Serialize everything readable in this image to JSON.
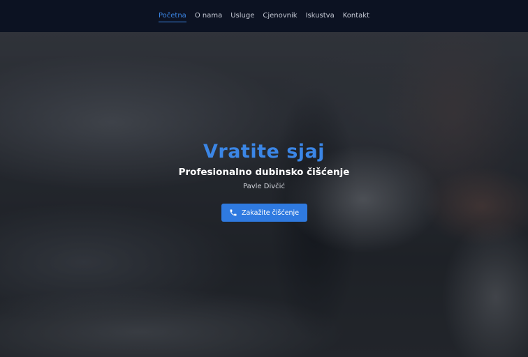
{
  "nav": {
    "items": [
      {
        "label": "Početna",
        "active": true
      },
      {
        "label": "O nama",
        "active": false
      },
      {
        "label": "Usluge",
        "active": false
      },
      {
        "label": "Cjenovnik",
        "active": false
      },
      {
        "label": "Iskustva",
        "active": false
      },
      {
        "label": "Kontakt",
        "active": false
      }
    ]
  },
  "hero": {
    "title": "Vratite sjaj",
    "subtitle": "Profesionalno dubinsko čišćenje",
    "author": "Pavle Divčić",
    "cta_label": "Zakažite čišćenje",
    "cta_icon": "phone-icon"
  },
  "colors": {
    "accent": "#3b86e6",
    "nav_bg": "#0c1222",
    "button_bg": "#2f7ae0"
  }
}
